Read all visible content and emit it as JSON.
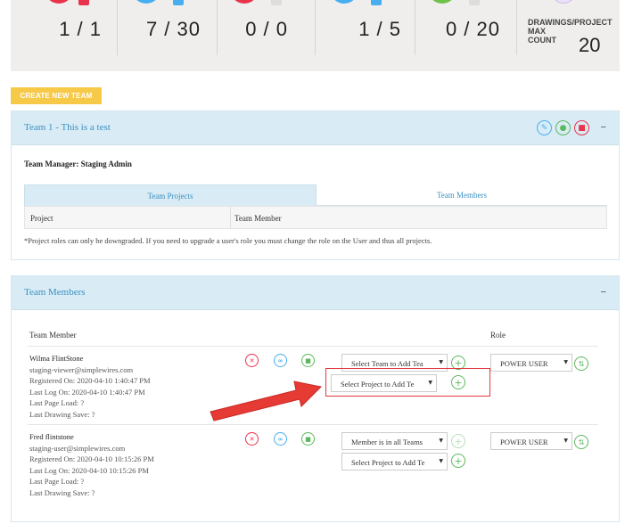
{
  "stats": [
    {
      "value": "1 / 1",
      "color": "#e8334a",
      "mini_color": "#e8334a"
    },
    {
      "value": "7 / 30",
      "color": "#47aef0",
      "mini_color": "#47aef0"
    },
    {
      "value": "0 / 0",
      "color": "#e8334a",
      "mini_color": "#dddddd"
    },
    {
      "value": "1 / 5",
      "color": "#47aef0",
      "mini_color": "#47aef0"
    },
    {
      "value": "0 / 20",
      "color": "#6dc24b",
      "mini_color": "#dddddd"
    }
  ],
  "drawings_stat": {
    "label": "DRAWINGS/PROJECT\nMAX\nCOUNT",
    "value": "20"
  },
  "create_team_button": "CREATE NEW TEAM",
  "team_panel": {
    "title": "Team 1 - This is a test",
    "collapse": "–",
    "manager": "Team Manager: Staging Admin",
    "tabs": [
      "Team Projects",
      "Team Members"
    ],
    "columns": [
      "Project",
      "Team Member"
    ],
    "note": "*Project roles can only be downgraded. If you need to upgrade a user's role you must change the role on the User and thus all projects."
  },
  "members_panel": {
    "title": "Team Members",
    "collapse": "–",
    "col_member": "Team Member",
    "col_role": "Role",
    "members": [
      {
        "name": "Wilma FlintStone",
        "email": "staging-viewer@simplewires.com",
        "registered": "Registered On: 2020-04-10 1:40:47 PM",
        "last_logon": "Last Log On: 2020-04-10 1:40:47 PM",
        "last_page_load": "Last Page Load: ?",
        "last_drawing_save": "Last Drawing Save: ?",
        "team_select": "Select Team to Add Tea",
        "project_select": "Select Project to Add Te",
        "role": "POWER USER"
      },
      {
        "name": "Fred flintstone",
        "email": "staging-user@simplewires.com",
        "registered": "Registered On: 2020-04-10 10:15:26 PM",
        "last_logon": "Last Log On: 2020-04-10 10:15:26 PM",
        "last_page_load": "Last Page Load: ?",
        "last_drawing_save": "Last Drawing Save: ?",
        "team_select": "Member is in all Teams",
        "project_select": "Select Project to Add Te",
        "role": "POWER USER"
      }
    ]
  }
}
